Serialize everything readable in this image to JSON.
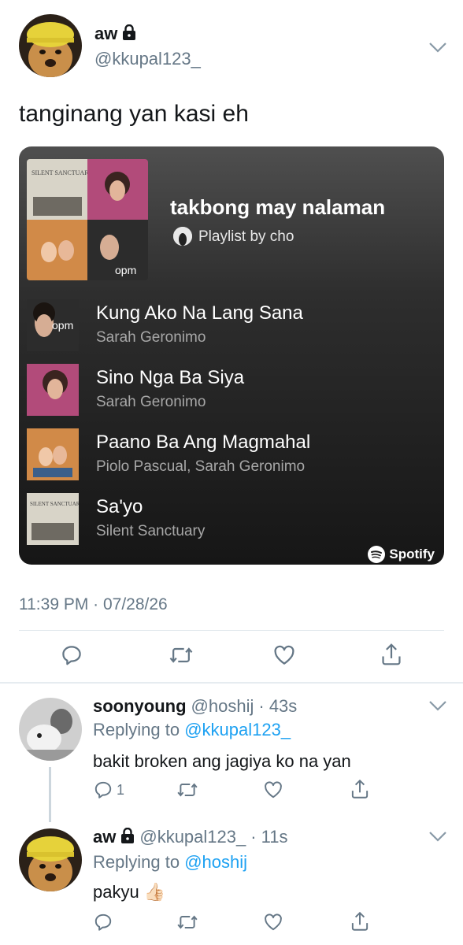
{
  "tweet": {
    "name": "aw",
    "handle": "@kkupal123_",
    "text": "tanginang yan kasi eh",
    "timestamp": "11:39 PM · 07/28/26"
  },
  "spotify_card": {
    "playlist_title": "takbong may nalaman",
    "playlist_by": "Playlist by cho",
    "brand": "Spotify",
    "tracks": [
      {
        "title": "Kung Ako Na Lang Sana",
        "artist": "Sarah Geronimo"
      },
      {
        "title": "Sino Nga Ba Siya",
        "artist": "Sarah Geronimo"
      },
      {
        "title": "Paano Ba Ang Magmahal",
        "artist": "Piolo Pascual, Sarah Geronimo"
      },
      {
        "title": "Sa'yo",
        "artist": "Silent Sanctuary"
      }
    ]
  },
  "replies": [
    {
      "name": "soonyoung",
      "handle": "@hoshij",
      "time": "· 43s",
      "replying_prefix": "Replying to",
      "replying_to": "@kkupal123_",
      "text": "bakit broken ang jagiya ko na yan",
      "reply_count": "1"
    },
    {
      "name": "aw",
      "handle": "@kkupal123_",
      "time": "· 11s",
      "replying_prefix": "Replying to",
      "replying_to": "@hoshij",
      "text": "pakyu",
      "emoji": "👍🏻"
    }
  ],
  "icons": [
    "reply-icon",
    "retweet-icon",
    "like-icon",
    "share-icon",
    "lock-icon",
    "chevron-down-icon",
    "spotify-icon"
  ],
  "colors": {
    "link": "#1da1f2",
    "secondary": "#657786",
    "card_bg": "#1c1c1c"
  }
}
